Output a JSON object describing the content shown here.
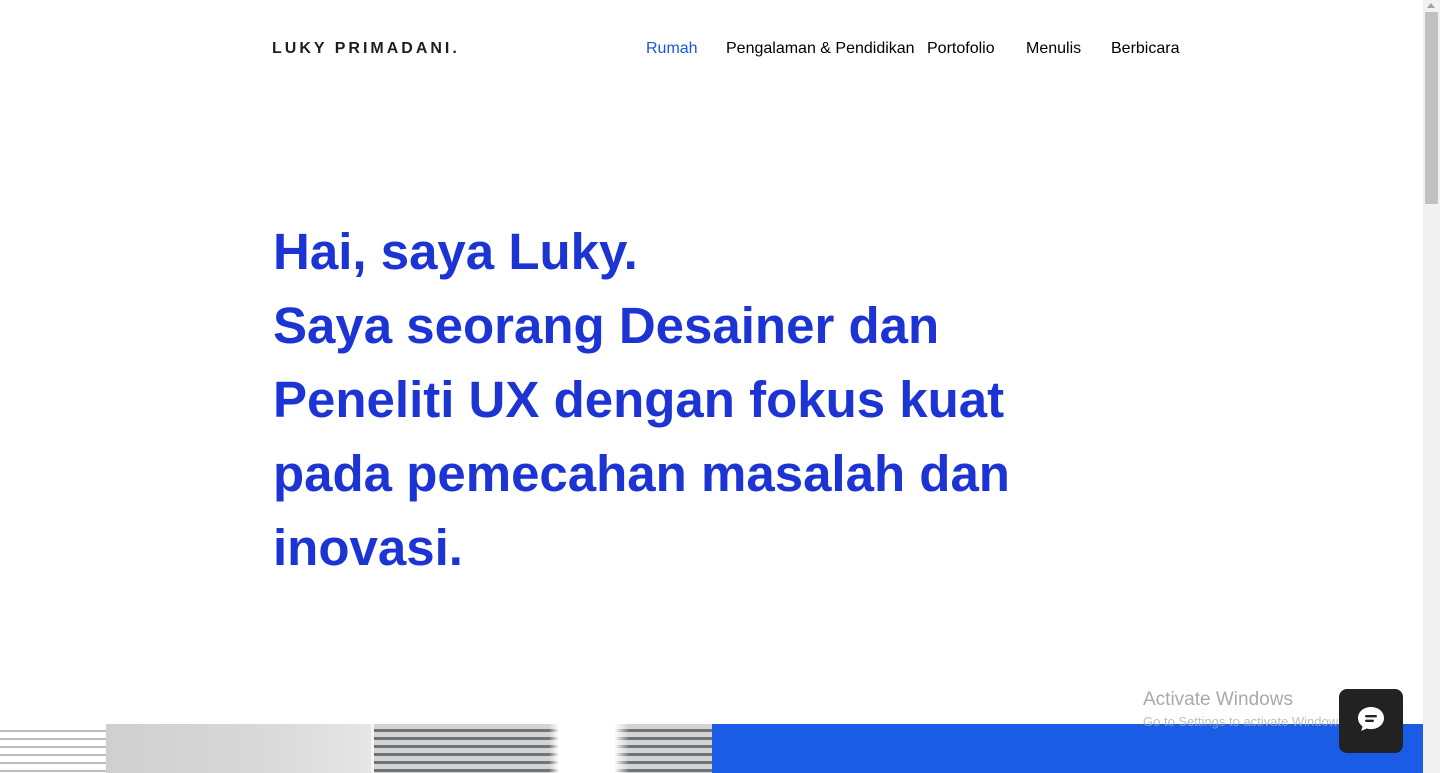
{
  "site": {
    "logo": "LUKY PRIMADANI."
  },
  "nav": {
    "items": [
      {
        "label": "Rumah",
        "active": true
      },
      {
        "label": "Pengalaman & Pendidikan",
        "active": false
      },
      {
        "label": "Portofolio",
        "active": false
      },
      {
        "label": "Menulis",
        "active": false
      },
      {
        "label": "Berbicara",
        "active": false
      }
    ]
  },
  "hero": {
    "lines": [
      "Hai, saya Luky.",
      "Saya seorang Desainer dan",
      "Peneliti UX dengan fokus kuat",
      "pada pemecahan masalah dan",
      "inovasi."
    ]
  },
  "os_watermark": {
    "title": "Activate Windows",
    "subtitle": "Go to Settings to activate Windows."
  },
  "chat": {
    "icon": "chat-bubble-icon"
  },
  "colors": {
    "accent": "#1b34d3",
    "nav_active": "#1a55e3",
    "banner_blue": "#1a5ce6",
    "chat_bg": "#222222"
  }
}
